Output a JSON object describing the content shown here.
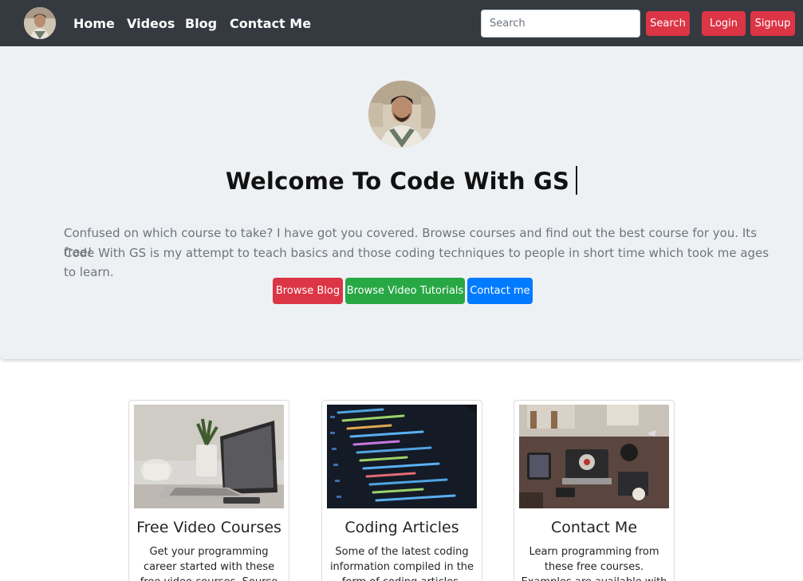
{
  "nav": {
    "links": [
      "Home",
      "Videos",
      "Blog",
      "Contact Me"
    ],
    "search_placeholder": "Search",
    "search_button": "Search",
    "login_button": "Login",
    "signup_button": "Signup"
  },
  "hero": {
    "title": "Welcome To Code With GS",
    "line1": "Confused on which course to take? I have got you covered. Browse courses and find out the best course for you. Its free!",
    "line2": "Code With GS is my attempt to teach basics and those coding techniques to people in short time which took me ages to learn.",
    "buttons": [
      "Browse Blog",
      "Browse Video Tutorials",
      "Contact me"
    ]
  },
  "cards": [
    {
      "title": "Free Video Courses",
      "text": "Get your programming career started with these free video courses. Source code is"
    },
    {
      "title": "Coding Articles",
      "text": "Some of the latest coding information compiled in the form of coding articles. Keep"
    },
    {
      "title": "Contact Me",
      "text": "Learn programming from these free courses. Examples are available with these"
    }
  ],
  "colors": {
    "navbar": "#343a40",
    "danger": "#dc3545",
    "success": "#28a745",
    "primary": "#007bff",
    "jumbotron": "#eef1f4"
  }
}
